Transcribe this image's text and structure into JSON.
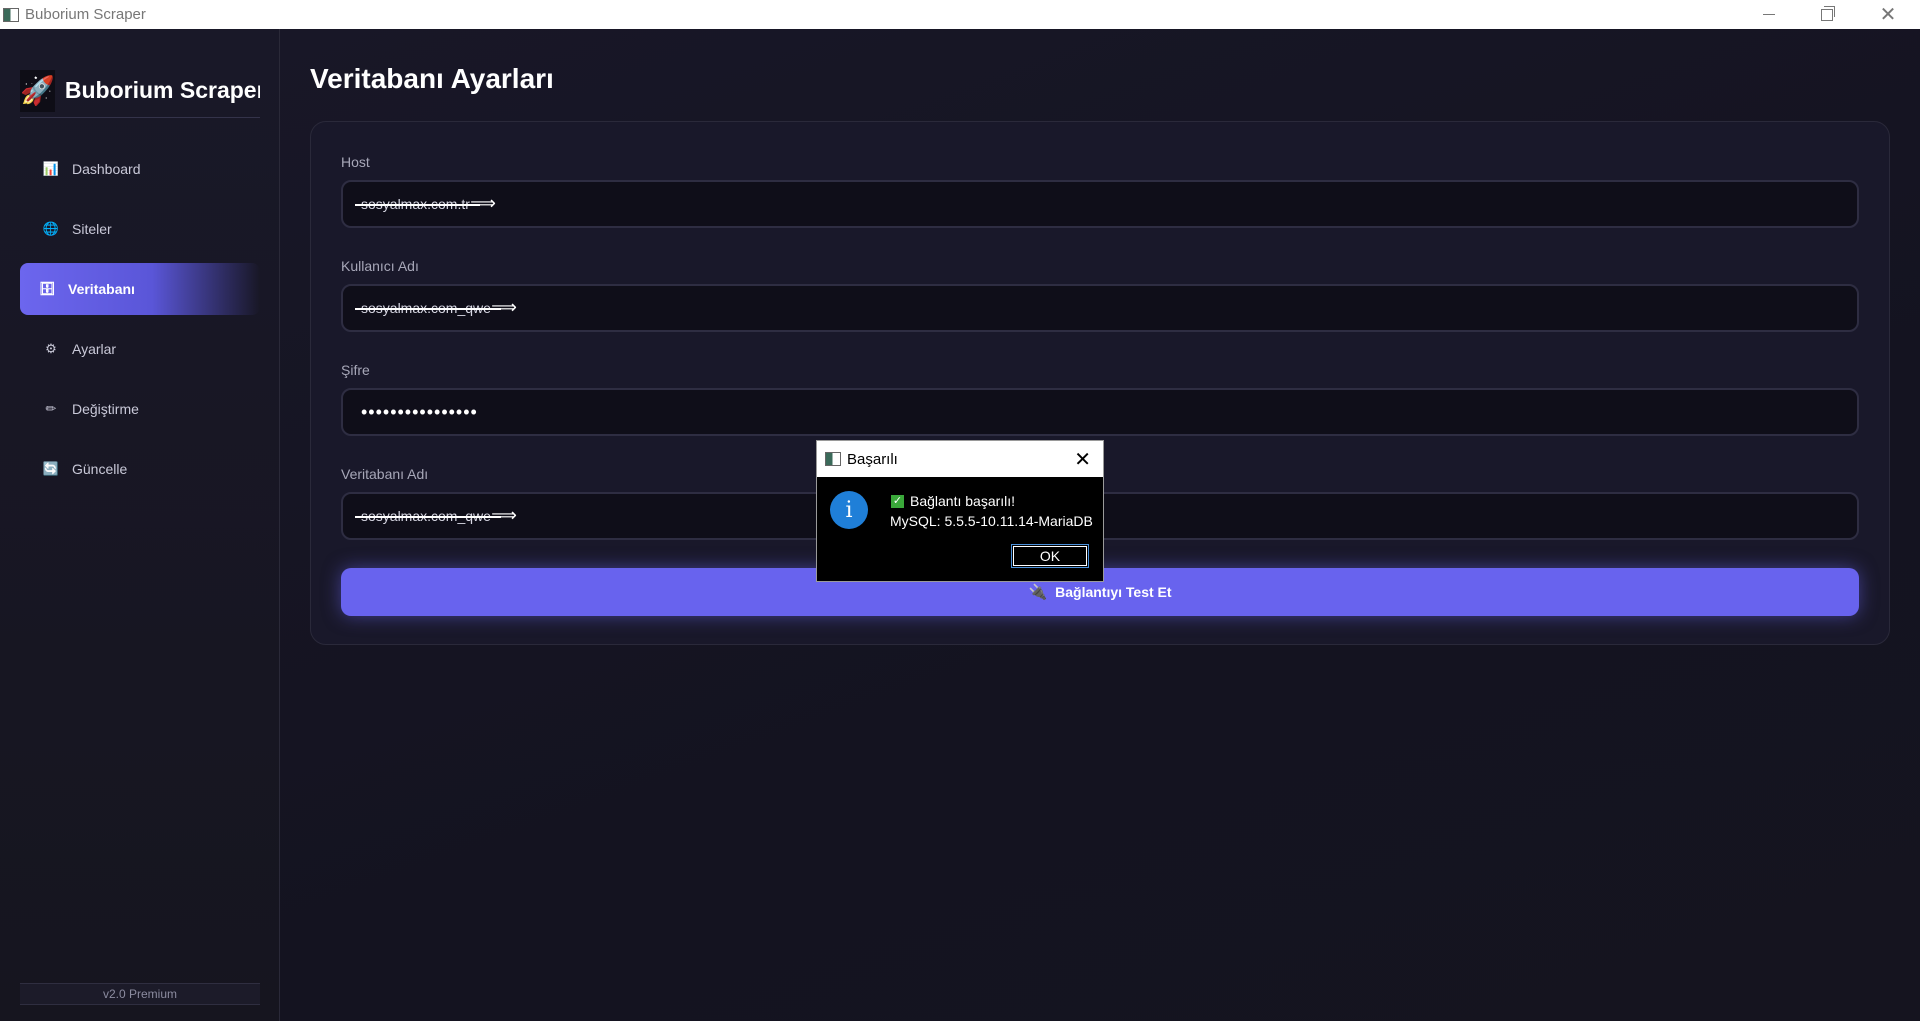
{
  "window": {
    "title": "Buborium Scraper",
    "minimize": "—",
    "close": "✕"
  },
  "sidebar": {
    "brand_icon": "🚀",
    "brand_title": "Buborium Scraper",
    "items": [
      {
        "icon": "📊",
        "label": "Dashboard",
        "active": false
      },
      {
        "icon": "🌐",
        "label": "Siteler",
        "active": false
      },
      {
        "icon": "🗄",
        "label": "Veritabanı",
        "active": true
      },
      {
        "icon": "⚙",
        "label": "Ayarlar",
        "active": false
      },
      {
        "icon": "✏",
        "label": "Değiştirme",
        "active": false
      },
      {
        "icon": "🔄",
        "label": "Güncelle",
        "active": false
      }
    ],
    "version": "v2.0 Premium"
  },
  "main": {
    "title": "Veritabanı Ayarları",
    "fields": {
      "host": {
        "label": "Host",
        "value": "sosyalmax.com.tr"
      },
      "username": {
        "label": "Kullanıcı Adı",
        "value": "sosyalmax.com_qwe"
      },
      "password": {
        "label": "Şifre",
        "value": "••••••••••••••••"
      },
      "database": {
        "label": "Veritabanı Adı",
        "value": "sosyalmax.com_qwe"
      }
    },
    "test_button": {
      "icon": "🔌",
      "label": "Bağlantıyı Test Et"
    }
  },
  "dialog": {
    "title": "Başarılı",
    "close": "✕",
    "info_icon": "i",
    "check": "✓",
    "message_line1": "Bağlantı başarılı!",
    "message_line2": "MySQL: 5.5.5-10.11.14-MariaDB",
    "ok_label": "OK"
  },
  "colors": {
    "accent": "#6863ee",
    "info": "#1f7fd8",
    "success": "#3aa83a"
  }
}
